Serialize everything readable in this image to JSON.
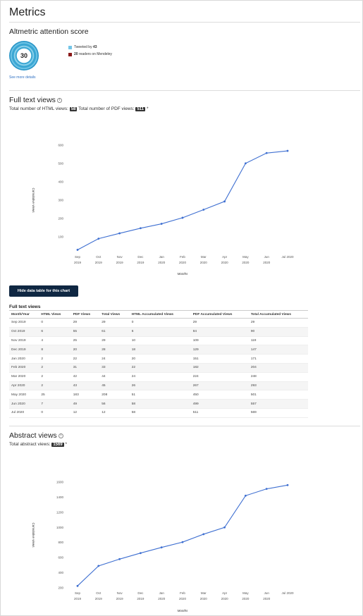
{
  "page": {
    "title": "Metrics"
  },
  "altmetric": {
    "heading": "Altmetric attention score",
    "score": "30",
    "legend": [
      {
        "color": "#74c6e8",
        "prefix": "Tweeted by ",
        "count": "43"
      },
      {
        "color": "#8b1a1a",
        "prefix": "",
        "count": "20",
        "suffix": " readers on Mendeley"
      }
    ],
    "see_more": "See more details"
  },
  "full_text": {
    "heading": "Full text views",
    "info_icon": "i",
    "html_label": "Total number of HTML views:",
    "html_value": "58",
    "pdf_label": "Total number of PDF views:",
    "pdf_value": "511",
    "note": "*"
  },
  "hide_button": "Hide data table for this chart",
  "table": {
    "title": "Full text views",
    "headers": [
      "Month/Year",
      "HTML Views",
      "PDF Views",
      "Total Views",
      "HTML Accumulated Views",
      "PDF Accumulated Views",
      "Total Accumulated Views"
    ],
    "rows": [
      [
        "Sep 2019",
        "0",
        "29",
        "29",
        "0",
        "29",
        "29"
      ],
      [
        "Oct 2019",
        "6",
        "55",
        "61",
        "6",
        "84",
        "90"
      ],
      [
        "Nov 2019",
        "4",
        "25",
        "29",
        "10",
        "109",
        "119"
      ],
      [
        "Dec 2019",
        "8",
        "20",
        "28",
        "18",
        "129",
        "147"
      ],
      [
        "Jan 2020",
        "2",
        "22",
        "24",
        "20",
        "151",
        "171"
      ],
      [
        "Feb 2020",
        "2",
        "31",
        "33",
        "22",
        "182",
        "204"
      ],
      [
        "Mar 2020",
        "2",
        "42",
        "44",
        "24",
        "224",
        "248"
      ],
      [
        "Apr 2020",
        "2",
        "43",
        "45",
        "26",
        "267",
        "293"
      ],
      [
        "May 2020",
        "25",
        "183",
        "208",
        "51",
        "450",
        "501"
      ],
      [
        "Jun 2020",
        "7",
        "49",
        "56",
        "58",
        "499",
        "557"
      ],
      [
        "Jul 2020",
        "0",
        "12",
        "12",
        "58",
        "511",
        "569"
      ]
    ]
  },
  "abstract": {
    "heading": "Abstract views",
    "info_icon": "i",
    "total_label": "Total abstract views:",
    "total_value": "1569",
    "note": "*"
  },
  "chart_data": [
    {
      "type": "line",
      "title": "",
      "xlabel": "Months",
      "ylabel": "Cumulative views",
      "categories": [
        [
          "Sep",
          "2019"
        ],
        [
          "Oct",
          "2019"
        ],
        [
          "Nov",
          "2019"
        ],
        [
          "Dec",
          "2019"
        ],
        [
          "Jan",
          "2020"
        ],
        [
          "Feb",
          "2020"
        ],
        [
          "Mar",
          "2020"
        ],
        [
          "Apr",
          "2020"
        ],
        [
          "May",
          "2020"
        ],
        [
          "Jun",
          "2020"
        ],
        [
          "Jul 2020",
          ""
        ]
      ],
      "yticks": [
        "100",
        "200",
        "300",
        "400",
        "500",
        "600"
      ],
      "ylim": [
        0,
        600
      ],
      "values": [
        29,
        90,
        119,
        147,
        171,
        204,
        248,
        293,
        501,
        557,
        569
      ],
      "color": "#3e6fd1",
      "grid": false
    },
    {
      "type": "line",
      "title": "",
      "xlabel": "Months",
      "ylabel": "Cumulative views",
      "categories": [
        [
          "Sep",
          "2019"
        ],
        [
          "Oct",
          "2019"
        ],
        [
          "Nov",
          "2019"
        ],
        [
          "Dec",
          "2019"
        ],
        [
          "Jan",
          "2020"
        ],
        [
          "Feb",
          "2020"
        ],
        [
          "Mar",
          "2020"
        ],
        [
          "Apr",
          "2020"
        ],
        [
          "May",
          "2020"
        ],
        [
          "Jun",
          "2020"
        ],
        [
          "Jul 2020",
          ""
        ]
      ],
      "yticks": [
        "200",
        "400",
        "600",
        "800",
        "1000",
        "1200",
        "1400",
        "1600"
      ],
      "ylim": [
        200,
        1600
      ],
      "values": [
        225,
        490,
        580,
        660,
        735,
        805,
        910,
        1000,
        1420,
        1510,
        1560
      ],
      "color": "#3e6fd1",
      "grid": false
    }
  ]
}
